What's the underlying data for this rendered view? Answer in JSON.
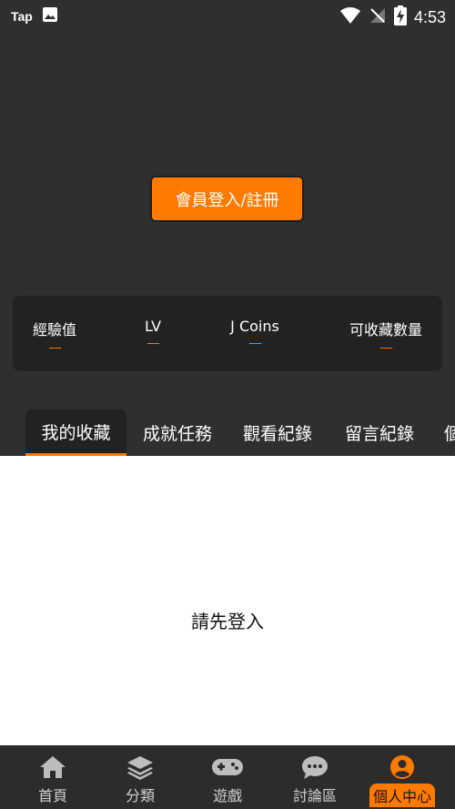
{
  "status_bar": {
    "app": "Tap",
    "time": "4:53"
  },
  "login_button": "會員登入/註冊",
  "stats": [
    {
      "label": "經驗值",
      "value": "----"
    },
    {
      "label": "LV",
      "value": "----"
    },
    {
      "label": "J Coins",
      "value": "----"
    },
    {
      "label": "可收藏數量",
      "value": "----"
    }
  ],
  "tabs": [
    {
      "label": "我的收藏",
      "active": true
    },
    {
      "label": "成就任務",
      "active": false
    },
    {
      "label": "觀看紀錄",
      "active": false
    },
    {
      "label": "留言紀錄",
      "active": false
    },
    {
      "label": "個",
      "active": false
    }
  ],
  "content": {
    "empty_message": "請先登入"
  },
  "bottom_nav": [
    {
      "label": "首頁",
      "icon": "home-icon"
    },
    {
      "label": "分類",
      "icon": "layers-icon"
    },
    {
      "label": "遊戲",
      "icon": "gamepad-icon"
    },
    {
      "label": "討論區",
      "icon": "chat-icon"
    },
    {
      "label": "個人中心",
      "icon": "profile-icon",
      "active": true
    }
  ],
  "colors": {
    "accent": "#ff7a00",
    "background": "#2f2f2f",
    "card": "#222222"
  }
}
